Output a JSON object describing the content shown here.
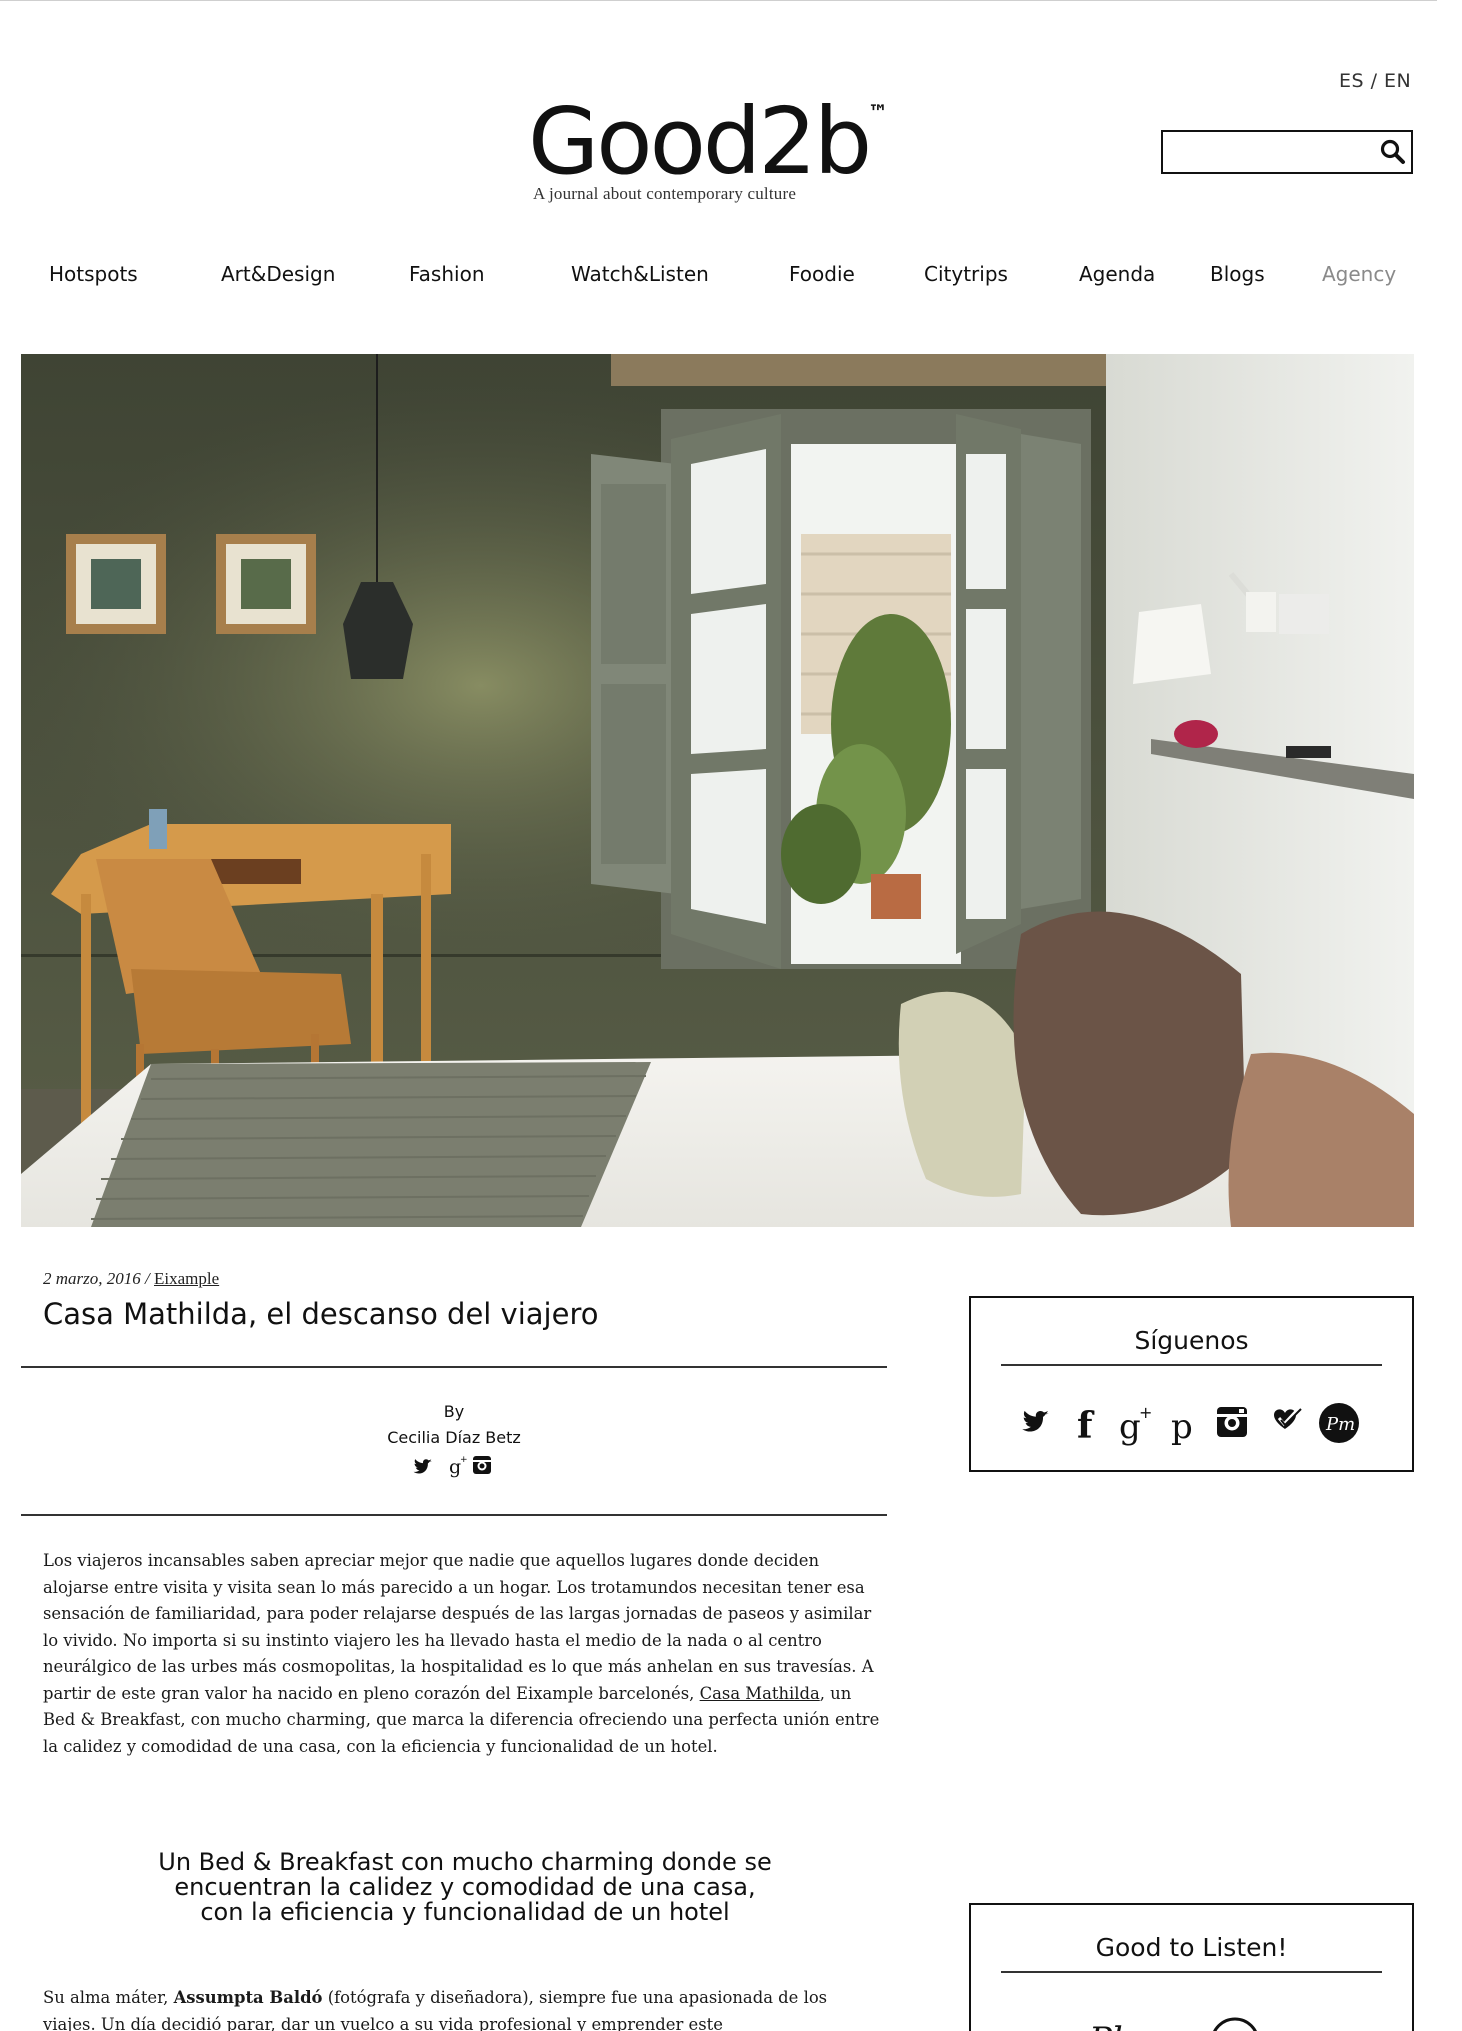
{
  "header": {
    "lang_switch": "ES / EN",
    "logo_text": "Good2b",
    "logo_tm": "™",
    "tagline": "A journal about contemporary culture",
    "search_placeholder": ""
  },
  "nav": {
    "items": [
      {
        "label": "Hotspots"
      },
      {
        "label": "Art&Design"
      },
      {
        "label": "Fashion"
      },
      {
        "label": "Watch&Listen"
      },
      {
        "label": "Foodie"
      },
      {
        "label": "Citytrips"
      },
      {
        "label": "Agenda"
      },
      {
        "label": "Blogs"
      },
      {
        "label": "Agency"
      }
    ]
  },
  "article": {
    "date": "2 marzo, 2016",
    "separator": " / ",
    "category": "Eixample",
    "title": "Casa Mathilda, el descanso del viajero",
    "by_label": "By",
    "author": "Cecilia Díaz Betz",
    "author_icons": [
      "twitter-icon",
      "google-plus-icon",
      "instagram-icon"
    ],
    "para1_before_link": "Los viajeros incansables saben apreciar mejor que nadie que aquellos lugares donde deciden alojarse entre visita y visita sean lo más parecido a un hogar. Los trotamundos necesitan tener esa sensación de familiaridad, para poder relajarse después de las largas jornadas de paseos y asimilar lo vivido. No importa si su instinto viajero les ha llevado hasta el medio de la nada o al centro neurálgico de las urbes más cosmopolitas, la hospitalidad es lo que más anhelan en sus travesías. A partir de este gran valor ha nacido en pleno corazón del Eixample barcelonés, ",
    "para1_link": "Casa Mathilda",
    "para1_after_link": ", un Bed & Breakfast, con mucho charming, que marca la diferencia ofreciendo una perfecta unión entre la calidez y comodidad de una casa, con la eficiencia y funcionalidad de un hotel.",
    "quote_lines": [
      "Un Bed & Breakfast con mucho charming donde se",
      "encuentran la calidez y comodidad de una casa,",
      "con la eficiencia y funcionalidad de un hotel"
    ],
    "para2_start": "Su alma máter, ",
    "para2_bold": "Assumpta Baldó",
    "para2_rest": " (fotógrafa y diseñadora), siempre fue una apasionada de los viajes. Un día decidió parar, dar un vuelco a su vida profesional y emprender este"
  },
  "sidebar": {
    "follow_title": "Síguenos",
    "social_icons": [
      "twitter-icon",
      "facebook-icon",
      "google-plus-icon",
      "pinterest-icon",
      "instagram-icon",
      "checkmark-heart-icon",
      "playmoss-icon"
    ],
    "listen_title": "Good to Listen!",
    "playmoss_label": "Playmoss"
  },
  "colors": {
    "text": "#111111",
    "muted_nav": "#8a8a8a",
    "wall": "#4e5340",
    "white_wall": "#e9eae6"
  }
}
